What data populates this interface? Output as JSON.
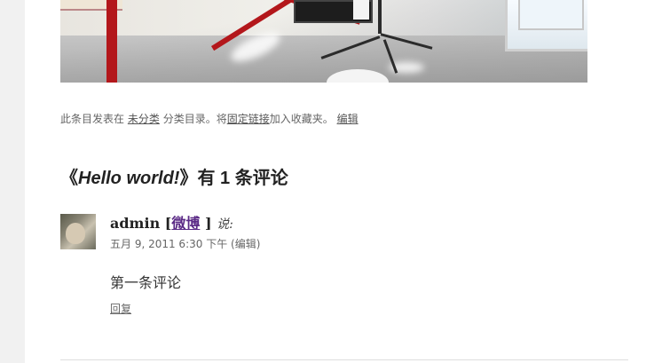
{
  "post_meta": {
    "prefix": "此条目发表在",
    "category_link": "未分类",
    "middle": "分类目录。将",
    "permalink": "固定链接",
    "suffix": "加入收藏夹。",
    "edit_link": "编辑"
  },
  "comments": {
    "title_open": "《",
    "title_post": "Hello world!",
    "title_close": "》有 1 条评论",
    "items": [
      {
        "author": "admin",
        "bracket_open": "[",
        "weibo_link": "微博",
        "bracket_close": "]",
        "says": "说:",
        "date": "五月 9, 2011 6:30 下午",
        "edit": "(编辑)",
        "body": "第一条评论",
        "reply": "回复"
      }
    ]
  },
  "colors": {
    "page_bg": "#ffffff",
    "side_bg": "#f1f1f1",
    "visited_link": "#5b2a86",
    "floor_stripe": "#b3171b"
  }
}
